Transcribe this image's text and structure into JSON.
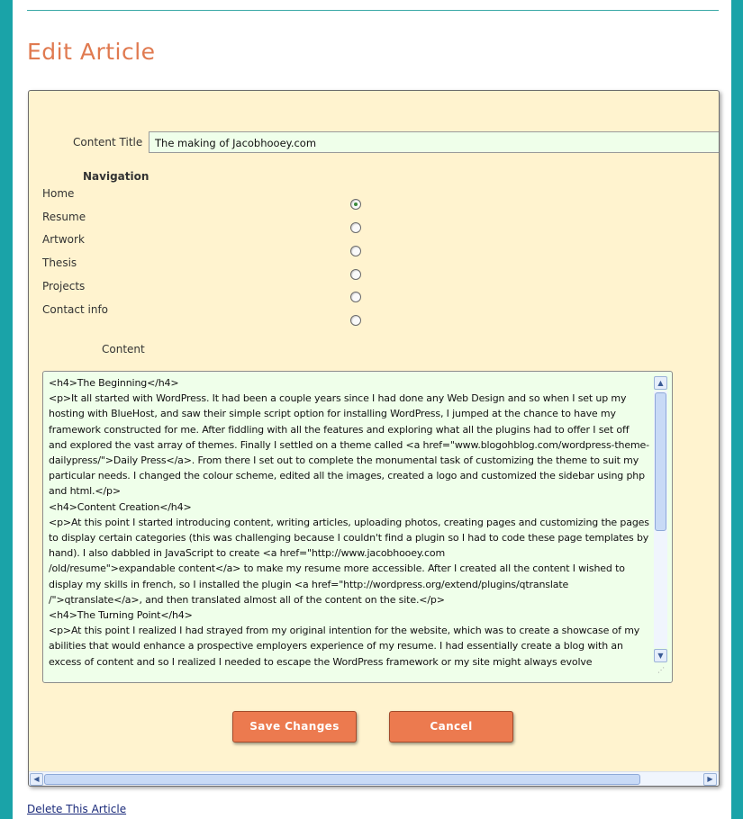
{
  "page": {
    "title": "Edit Article",
    "accent_color": "#e07a50",
    "frame_color": "#1aa3a8",
    "panel_bg": "#fff3cf"
  },
  "form": {
    "content_title_label": "Content Title",
    "content_title_value": "The making of Jacobhooey.com",
    "navigation_heading": "Navigation",
    "navigation_options": [
      {
        "label": "Home",
        "checked": true
      },
      {
        "label": "Resume",
        "checked": false
      },
      {
        "label": "Artwork",
        "checked": false
      },
      {
        "label": "Thesis",
        "checked": false
      },
      {
        "label": "Projects",
        "checked": false
      },
      {
        "label": "Contact info",
        "checked": false
      }
    ],
    "content_label": "Content",
    "content_value": "<h4>The Beginning</h4>\n<p>It all started with WordPress. It had been a couple years since I had done any Web Design and so when I set up my hosting with BlueHost, and saw their simple script option for installing WordPress, I jumped at the chance to have my framework constructed for me. After fiddling with all the features and exploring what all the plugins had to offer I set off and explored the vast array of themes. Finally I settled on a theme called <a href=\"www.blogohblog.com/wordpress-theme-dailypress/\">Daily Press</a>. From there I set out to complete the monumental task of customizing the theme to suit my particular needs. I changed the colour scheme, edited all the images, created a logo and customized the sidebar using php and html.</p>\n<h4>Content Creation</h4>\n<p>At this point I started introducing content, writing articles, uploading photos, creating pages and customizing the pages to display certain categories (this was challenging because I couldn't find a plugin so I had to code these page templates by hand). I also dabbled in JavaScript to create <a href=\"http://www.jacobhooey.com\n/old/resume\">expandable content</a> to make my resume more accessible. After I created all the content I wished to display my skills in french, so I installed the plugin <a href=\"http://wordpress.org/extend/plugins/qtranslate\n/\">qtranslate</a>, and then translated almost all of the content on the site.</p>\n<h4>The Turning Point</h4>\n<p>At this point I realized I had strayed from my original intention for the website, which was to create a showcase of my abilities that would enhance a prospective employers experience of my resume. I had essentially create a blog with an excess of content and so I realized I needed to escape the WordPress framework or my site might always evolve",
    "save_button": "Save Changes",
    "cancel_button": "Cancel"
  },
  "footer": {
    "delete_link": "Delete This Article"
  },
  "icons": {
    "scroll_up": "▲",
    "scroll_down": "▼",
    "scroll_left": "◀",
    "scroll_right": "▶",
    "resize_grip": "⋰"
  }
}
